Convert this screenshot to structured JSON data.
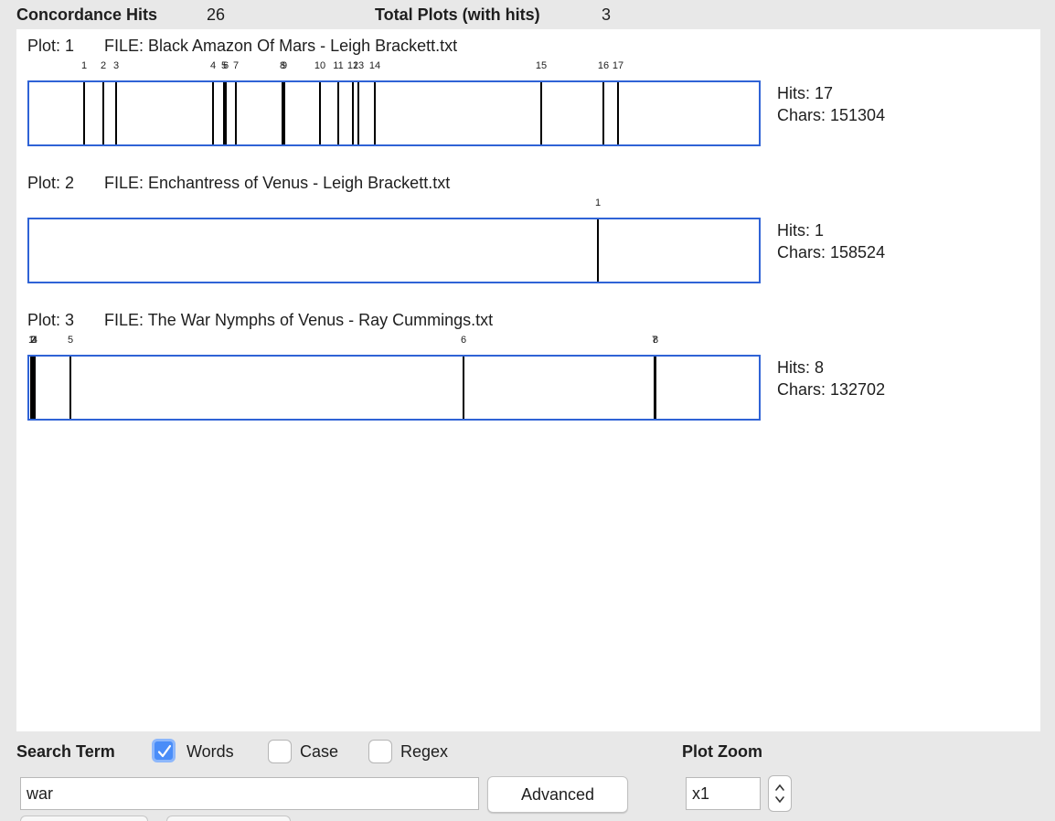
{
  "summary": {
    "hits_label": "Concordance Hits",
    "hits_value": "26",
    "plots_label": "Total Plots (with hits)",
    "plots_value": "3"
  },
  "plots": [
    {
      "plot_label": "Plot: 1",
      "file_label": "FILE: Black Amazon Of Mars - Leigh Brackett.txt",
      "hits_text": "Hits: 17",
      "chars_text": "Chars: 151304",
      "hits": [
        {
          "label": "1",
          "pos": 0.075
        },
        {
          "label": "2",
          "pos": 0.102
        },
        {
          "label": "3",
          "pos": 0.119
        },
        {
          "label": "4",
          "pos": 0.252
        },
        {
          "label": "5",
          "pos": 0.267
        },
        {
          "label": "6",
          "pos": 0.27
        },
        {
          "label": "7",
          "pos": 0.283
        },
        {
          "label": "8",
          "pos": 0.347
        },
        {
          "label": "9",
          "pos": 0.349
        },
        {
          "label": "10",
          "pos": 0.399
        },
        {
          "label": "11",
          "pos": 0.424
        },
        {
          "label": "12",
          "pos": 0.443
        },
        {
          "label": "13",
          "pos": 0.451
        },
        {
          "label": "14",
          "pos": 0.474
        },
        {
          "label": "15",
          "pos": 0.702
        },
        {
          "label": "16",
          "pos": 0.787
        },
        {
          "label": "17",
          "pos": 0.807
        }
      ]
    },
    {
      "plot_label": "Plot: 2",
      "file_label": "FILE: Enchantress of Venus - Leigh Brackett.txt",
      "hits_text": "Hits: 1",
      "chars_text": "Chars: 158524",
      "hits": [
        {
          "label": "1",
          "pos": 0.78
        }
      ]
    },
    {
      "plot_label": "Plot: 3",
      "file_label": "FILE: The War Nymphs of Venus - Ray Cummings.txt",
      "hits_text": "Hits: 8",
      "chars_text": "Chars: 132702",
      "hits": [
        {
          "label": "1",
          "pos": 0.003
        },
        {
          "label": "2",
          "pos": 0.005
        },
        {
          "label": "3",
          "pos": 0.006
        },
        {
          "label": "4",
          "pos": 0.007
        },
        {
          "label": "5",
          "pos": 0.056
        },
        {
          "label": "6",
          "pos": 0.595
        },
        {
          "label": "7",
          "pos": 0.857
        },
        {
          "label": "8",
          "pos": 0.858
        }
      ]
    }
  ],
  "controls": {
    "search_term_label": "Search Term",
    "words_label": "Words",
    "words_checked": true,
    "case_label": "Case",
    "case_checked": false,
    "regex_label": "Regex",
    "regex_checked": false,
    "search_value": "war",
    "advanced_label": "Advanced",
    "zoom_label": "Plot Zoom",
    "zoom_value": "x1"
  },
  "colors": {
    "plot_border": "#2f63d6",
    "hit_line": "#000000",
    "checkbox_accent": "#4a8df8"
  }
}
